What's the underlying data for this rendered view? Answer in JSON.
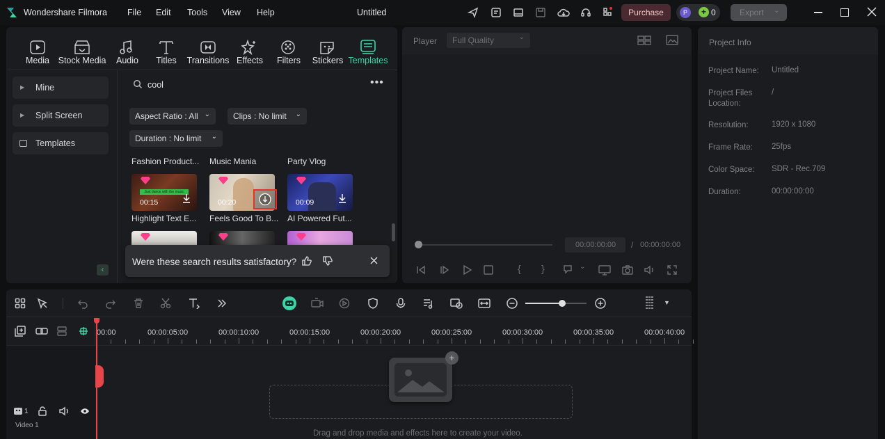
{
  "app": {
    "name": "Wondershare Filmora",
    "doc_title": "Untitled"
  },
  "menu": [
    "File",
    "Edit",
    "Tools",
    "View",
    "Help"
  ],
  "titlebar": {
    "purchase": "Purchase",
    "avatar": "P",
    "credits": "0",
    "export": "Export"
  },
  "tabs": [
    {
      "label": "Media",
      "icon": "media-icon"
    },
    {
      "label": "Stock Media",
      "icon": "stock-media-icon"
    },
    {
      "label": "Audio",
      "icon": "music-note-icon"
    },
    {
      "label": "Titles",
      "icon": "title-T-icon"
    },
    {
      "label": "Transitions",
      "icon": "transitions-icon"
    },
    {
      "label": "Effects",
      "icon": "effects-sparkle-icon"
    },
    {
      "label": "Filters",
      "icon": "filters-icon"
    },
    {
      "label": "Stickers",
      "icon": "stickers-icon"
    },
    {
      "label": "Templates",
      "icon": "templates-icon",
      "active": true
    }
  ],
  "sidebar": {
    "items": [
      {
        "label": "Mine"
      },
      {
        "label": "Split Screen"
      },
      {
        "label": "Templates"
      }
    ]
  },
  "search": {
    "value": "cool"
  },
  "filters": {
    "aspect": "Aspect Ratio : All",
    "clips": "Clips : No limit",
    "duration": "Duration : No limit"
  },
  "template_groups": [
    "Fashion Product...",
    "Music Mania",
    "Party Vlog"
  ],
  "templates": [
    {
      "title": "Highlight Text E...",
      "duration": "00:15",
      "overlay": "Just dance with the music"
    },
    {
      "title": "Feels Good To B...",
      "duration": "00:20"
    },
    {
      "title": "AI Powered Fut...",
      "duration": "00:09"
    }
  ],
  "feedback": {
    "question": "Were these search results satisfactory?"
  },
  "player": {
    "label": "Player",
    "quality": "Full Quality",
    "current": "00:00:00:00",
    "separator": "/",
    "total": "00:00:00:00"
  },
  "project_info": {
    "title": "Project Info",
    "rows": [
      {
        "key": "Project Name:",
        "value": "Untitled"
      },
      {
        "key": "Project Files Location:",
        "value": "/"
      },
      {
        "key": "Resolution:",
        "value": "1920 x 1080"
      },
      {
        "key": "Frame Rate:",
        "value": "25fps"
      },
      {
        "key": "Color Space:",
        "value": "SDR - Rec.709"
      },
      {
        "key": "Duration:",
        "value": "00:00:00:00"
      }
    ]
  },
  "timeline": {
    "ruler": [
      "00:00",
      "00:00:05:00",
      "00:00:10:00",
      "00:00:15:00",
      "00:00:20:00",
      "00:00:25:00",
      "00:00:30:00",
      "00:00:35:00",
      "00:00:40:00"
    ],
    "track": {
      "label": "Video 1",
      "number": "1"
    },
    "drop_hint": "Drag and drop media and effects here to create your video.",
    "zoom_level": 0.5
  },
  "colors": {
    "accent": "#3fd3a8",
    "purchase_bg": "#4a2a30",
    "highlight_red": "#e5322d"
  }
}
